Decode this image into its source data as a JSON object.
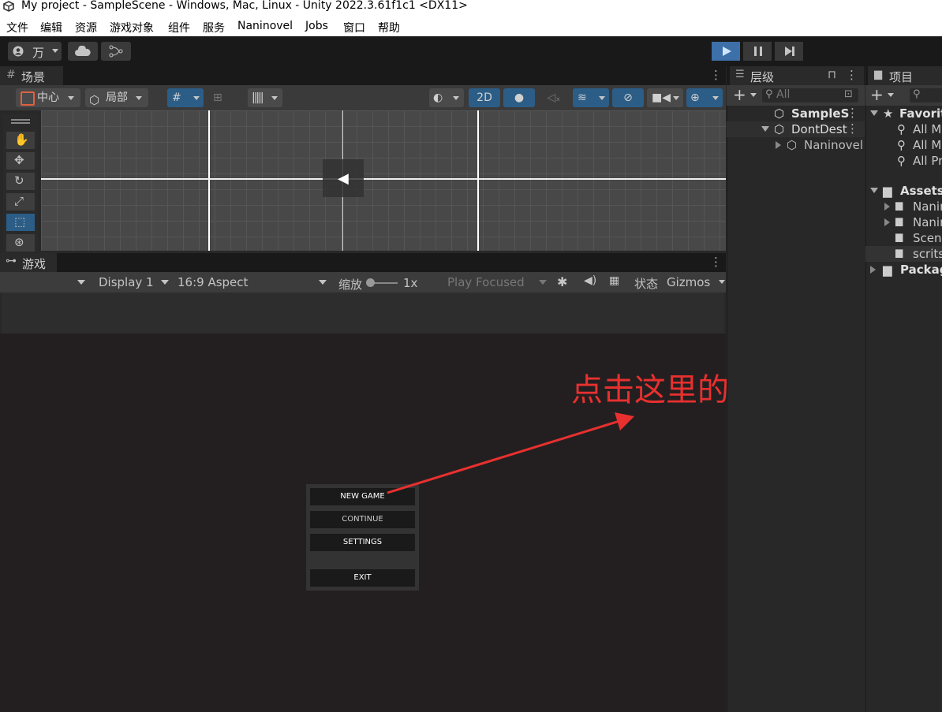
{
  "window": {
    "title": "My project - SampleScene - Windows, Mac, Linux - Unity 2022.3.61f1c1 <DX11>"
  },
  "menu": [
    "文件",
    "编辑",
    "资源",
    "游戏对象",
    "组件",
    "服务",
    "Naninovel",
    "Jobs",
    "窗口",
    "帮助"
  ],
  "toolbar": {
    "account_label": "万"
  },
  "scene": {
    "tab": "场景",
    "pivot": "中心",
    "space": "局部",
    "mode_2d": "2D"
  },
  "game": {
    "tab": "游戏",
    "display": "Display 1",
    "aspect": "16:9 Aspect",
    "scale_label": "缩放",
    "scale_value": "1x",
    "play_mode": "Play Focused",
    "stats": "状态",
    "gizmos": "Gizmos",
    "menu_items": [
      "NEW GAME",
      "CONTINUE",
      "SETTINGS",
      "EXIT"
    ]
  },
  "hierarchy": {
    "tab": "层级",
    "search_placeholder": "All",
    "items": [
      "SampleS",
      "DontDest",
      "Naninovel"
    ]
  },
  "project": {
    "tab": "项目",
    "favorites": "Favorit",
    "fav_items": [
      "All M",
      "All M",
      "All Pr"
    ],
    "assets": "Assets",
    "asset_items": [
      "Nanin",
      "Nanin",
      "Scene",
      "scrits"
    ],
    "packages": "Packag"
  },
  "annotation": "点击这里的NEW GAME",
  "colors": {
    "annotation": "#e8302f",
    "play_accent": "#3d8fe0",
    "selection": "#2c5d87"
  }
}
